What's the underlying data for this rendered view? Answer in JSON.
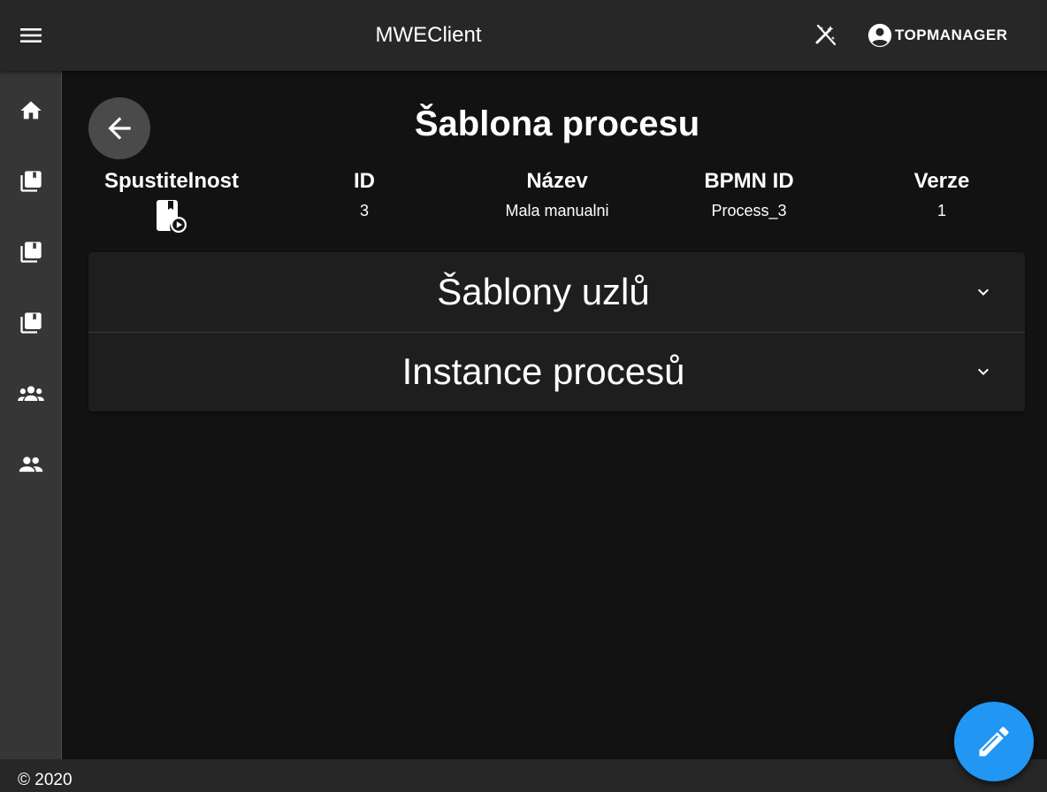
{
  "header": {
    "title": "MWEClient",
    "user_name": "TOPMANAGER",
    "menu_icon": "menu-icon",
    "theme_icon": "theme-toggle-icon",
    "user_icon": "account-circle-icon"
  },
  "sidebar": {
    "items": [
      {
        "name": "home",
        "icon": "home-icon"
      },
      {
        "name": "library-1",
        "icon": "library-books-icon"
      },
      {
        "name": "library-2",
        "icon": "library-books-icon"
      },
      {
        "name": "library-3",
        "icon": "library-books-icon"
      },
      {
        "name": "groups",
        "icon": "groups-icon"
      },
      {
        "name": "people",
        "icon": "people-icon"
      }
    ]
  },
  "page": {
    "title": "Šablona procesu",
    "back_icon": "arrow-back-icon"
  },
  "details": {
    "columns": [
      {
        "header": "Spustitelnost",
        "value_icon": "runnable-book-play-icon"
      },
      {
        "header": "ID",
        "value": "3"
      },
      {
        "header": "Název",
        "value": "Mala manualni"
      },
      {
        "header": "BPMN ID",
        "value": "Process_3"
      },
      {
        "header": "Verze",
        "value": "1"
      }
    ]
  },
  "accordion": {
    "sections": [
      {
        "title": "Šablony uzlů",
        "expanded": false
      },
      {
        "title": "Instance procesů",
        "expanded": false
      }
    ]
  },
  "footer": {
    "copyright": "© 2020"
  },
  "fab": {
    "icon": "edit-pencil-icon",
    "color": "#2196f3"
  },
  "colors": {
    "appbar": "#272727",
    "sidebar": "#363636",
    "background": "#121212",
    "panel": "#1e1e1e",
    "accent": "#2196f3"
  }
}
